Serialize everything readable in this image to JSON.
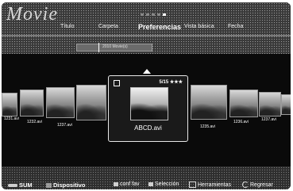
{
  "header": {
    "title": "Movie",
    "tabs": [
      {
        "label": "Título",
        "active": false
      },
      {
        "label": "Carpeta",
        "active": false
      },
      {
        "label": "Preferencias",
        "active": true
      },
      {
        "label": "Vista básica",
        "active": false
      },
      {
        "label": "Fecha",
        "active": false
      }
    ],
    "progress_label": "2010 Movie(s)"
  },
  "focused": {
    "filename": "ABCD.avi",
    "rating_text": "5/15",
    "stars": "★★★"
  },
  "thumbnails": [
    {
      "label": "1231.avi"
    },
    {
      "label": "1232.avi"
    },
    {
      "label": "1237.avi"
    },
    {
      "label": "1235.avi"
    },
    {
      "label": "1236.avi"
    },
    {
      "label": "1237.avi"
    }
  ],
  "footer": {
    "sum_label": "SUM",
    "device_label": "Dispositivo",
    "fav_label": "conf fav",
    "select_label": "Selección",
    "tools_label": "Herramientas",
    "return_label": "Regresar"
  }
}
